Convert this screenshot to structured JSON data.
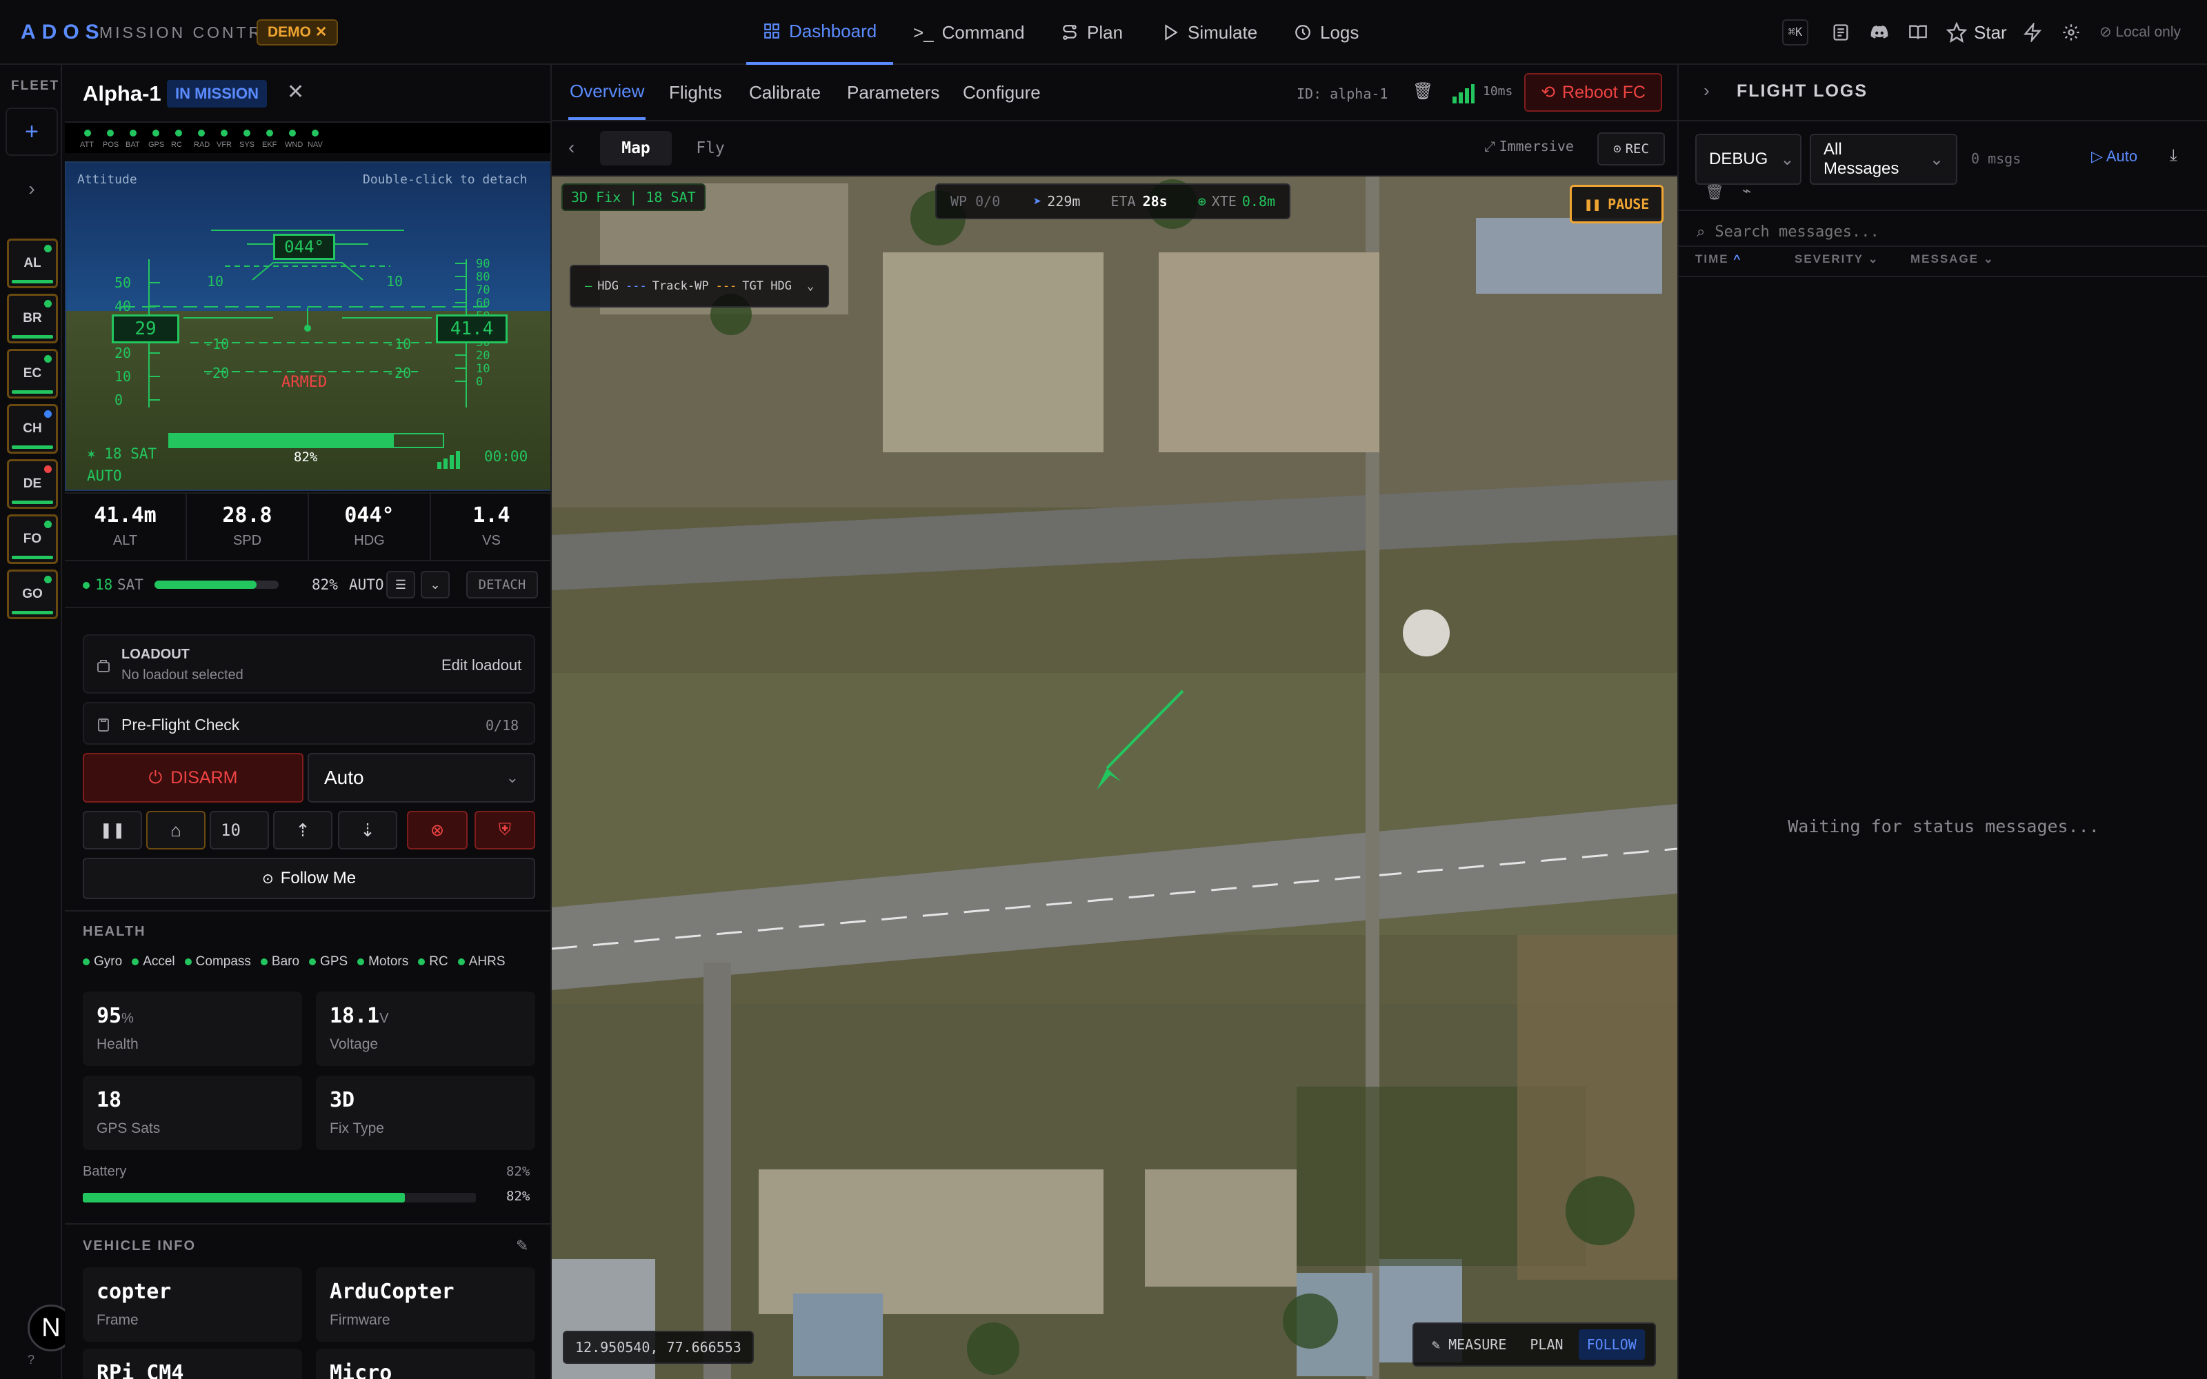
{
  "topbar": {
    "logo": "ADOS",
    "subtitle": "MISSION CONTROL",
    "demo_badge": "DEMO",
    "nav": [
      {
        "label": "Dashboard",
        "icon": "grid-icon",
        "active": true
      },
      {
        "label": "Command",
        "icon": "terminal-icon"
      },
      {
        "label": "Plan",
        "icon": "route-icon"
      },
      {
        "label": "Simulate",
        "icon": "play-icon"
      },
      {
        "label": "Logs",
        "icon": "history-icon"
      }
    ],
    "shortcut": "⌘K",
    "star_label": "Star",
    "local_label": "Local only"
  },
  "fleet": {
    "title": "FLEET",
    "items": [
      {
        "code": "AL",
        "status_color": "#22c55e"
      },
      {
        "code": "BR",
        "status_color": "#22c55e"
      },
      {
        "code": "EC",
        "status_color": "#22c55e"
      },
      {
        "code": "CH",
        "status_color": "#3b82f6"
      },
      {
        "code": "DE",
        "status_color": "#ef4444"
      },
      {
        "code": "FO",
        "status_color": "#22c55e"
      },
      {
        "code": "GO",
        "status_color": "#22c55e"
      }
    ],
    "help": "?"
  },
  "vehicle": {
    "name": "Alpha-1",
    "status": "IN MISSION",
    "subsystems": [
      "ATT",
      "POS",
      "BAT",
      "GPS",
      "RC",
      "RAD",
      "VFR",
      "SYS",
      "EKF",
      "WND",
      "NAV"
    ],
    "hud": {
      "label": "Attitude",
      "hint": "Double-click to detach",
      "heading": "044°",
      "speed": "29",
      "altitude": "41.4",
      "armed": "ARMED",
      "battery_pct": "82%",
      "battery_level": 0.82,
      "sats": "✶ 18 SAT",
      "mode": "AUTO",
      "timer": "00:00",
      "pitch_labels": [
        "10",
        "-10",
        "-20"
      ],
      "speed_ticks": [
        "50",
        "40",
        "30",
        "20",
        "10",
        "0"
      ],
      "alt_ticks": [
        "90",
        "80",
        "70",
        "60",
        "50",
        "40",
        "30",
        "20",
        "10",
        "0"
      ]
    },
    "metrics": [
      {
        "value": "41.4m",
        "label": "ALT"
      },
      {
        "value": "28.8",
        "label": "SPD"
      },
      {
        "value": "044°",
        "label": "HDG"
      },
      {
        "value": "1.4",
        "label": "VS"
      }
    ],
    "gps_row": {
      "sats": "18",
      "sat_label": "SAT",
      "battery": "82%",
      "battery_level": 0.82,
      "mode": "AUTO",
      "detach": "DETACH"
    },
    "loadout": {
      "title": "LOADOUT",
      "subtitle": "No loadout selected",
      "edit": "Edit loadout"
    },
    "preflight": {
      "label": "Pre-Flight Check",
      "count": "0/18"
    },
    "disarm": "DISARM",
    "flight_mode": "Auto",
    "altitude_input": "10",
    "follow_me": "Follow Me",
    "health": {
      "title": "HEALTH",
      "sensors": [
        "Gyro",
        "Accel",
        "Compass",
        "Baro",
        "GPS",
        "Motors",
        "RC",
        "AHRS"
      ],
      "stats": [
        {
          "value": "95",
          "unit": "%",
          "label": "Health"
        },
        {
          "value": "18.1",
          "unit": "V",
          "label": "Voltage"
        },
        {
          "value": "18",
          "unit": "",
          "label": "GPS Sats"
        },
        {
          "value": "3D",
          "unit": "",
          "label": "Fix Type"
        }
      ],
      "battery_label": "Battery",
      "battery_pct": "82%",
      "battery_level": 0.82
    },
    "vehicle_info": {
      "title": "VEHICLE INFO",
      "items": [
        {
          "value": "copter",
          "label": "Frame"
        },
        {
          "value": "ArduCopter",
          "label": "Firmware"
        },
        {
          "value": "RPi CM4",
          "label": ""
        },
        {
          "value": "Micro",
          "label": ""
        }
      ]
    }
  },
  "center": {
    "tabs": [
      "Overview",
      "Flights",
      "Calibrate",
      "Parameters",
      "Configure"
    ],
    "active_tab": "Overview",
    "vehicle_id": "ID: alpha-1",
    "latency": "10ms",
    "reboot": "Reboot FC",
    "view_tabs": [
      "Map",
      "Fly"
    ],
    "immersive": "Immersive",
    "rec": "REC",
    "map": {
      "fix": "3D Fix | 18 SAT",
      "wp": "WP 0/0",
      "distance": "229m",
      "eta_label": "ETA",
      "eta": "28s",
      "xte_label": "XTE",
      "xte": "0.8m",
      "pause": "PAUSE",
      "legend": {
        "hdg": "HDG",
        "track": "Track-WP",
        "tgt": "TGT HDG"
      },
      "coords": "12.950540, 77.666553",
      "tools": [
        "MEASURE",
        "PLAN",
        "FOLLOW"
      ],
      "active_tool": "FOLLOW"
    }
  },
  "logs": {
    "title": "FLIGHT LOGS",
    "level": "DEBUG",
    "filter": "All Messages",
    "count": "0 msgs",
    "auto": "Auto",
    "search_placeholder": "Search messages...",
    "columns": [
      "TIME",
      "SEVERITY",
      "MESSAGE"
    ],
    "empty": "Waiting for status messages..."
  },
  "colors": {
    "accent": "#5b8cff",
    "ok": "#22c55e",
    "danger": "#ef4444",
    "warning": "#f0a532"
  }
}
